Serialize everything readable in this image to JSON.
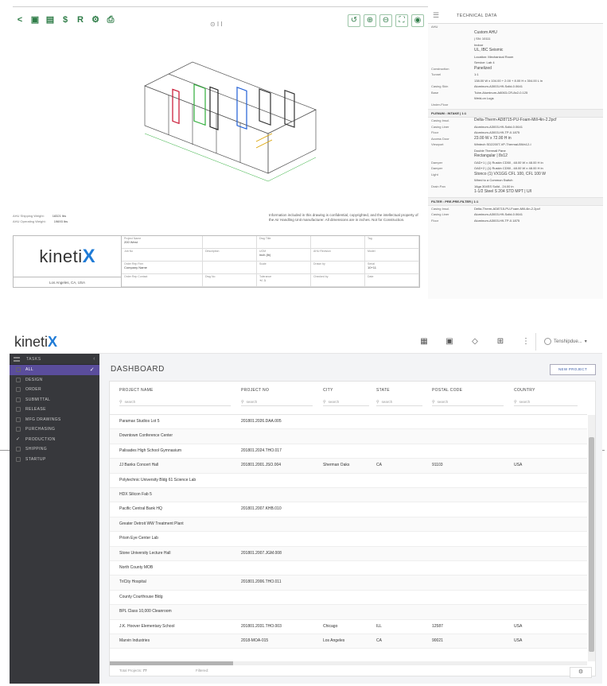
{
  "viewer": {
    "toolbar_left": [
      {
        "icon": "share-icon",
        "glyph": "<"
      },
      {
        "icon": "camera-icon",
        "glyph": "▣"
      },
      {
        "icon": "save-icon",
        "glyph": "▤"
      },
      {
        "icon": "dollar-icon",
        "glyph": "$"
      },
      {
        "icon": "report-icon",
        "glyph": "R"
      },
      {
        "icon": "settings-icon",
        "glyph": "⚙"
      },
      {
        "icon": "print-icon",
        "glyph": "⎙"
      }
    ],
    "toolbar_right": [
      {
        "icon": "rotate-icon",
        "glyph": "↺"
      },
      {
        "icon": "zoom-in-icon",
        "glyph": "⊕"
      },
      {
        "icon": "zoom-out-icon",
        "glyph": "⊖"
      },
      {
        "icon": "fullscreen-icon",
        "glyph": "⛶"
      },
      {
        "icon": "eye-icon",
        "glyph": "◉"
      }
    ],
    "pager": "⊙ I I",
    "weights": [
      {
        "label": "AHU Shipping Weight:",
        "value": "18321 lbs"
      },
      {
        "label": "AHU Operating Weight:",
        "value": "19693 lbs"
      }
    ],
    "notice": "Information included in this drawing is confidential, copyrighted, and the intellectual property of the Air Handling Unit manufacturer. All dimensions are in inches. Not for Construction.",
    "titleblock": {
      "logo_text": "kineti",
      "logo_x": "X",
      "location": "Los Angeles, CA, USA",
      "cells": [
        {
          "label": "Project Name",
          "value": "200 West"
        },
        {
          "label": "",
          "value": ""
        },
        {
          "label": "Dwg Title",
          "value": ""
        },
        {
          "label": "",
          "value": ""
        },
        {
          "label": "Tag",
          "value": ""
        },
        {
          "label": "Job No",
          "value": ""
        },
        {
          "label": "Description",
          "value": ""
        },
        {
          "label": "UOM",
          "value": "inch (lb)"
        },
        {
          "label": "AHU Revision",
          "value": ""
        },
        {
          "label": "Model",
          "value": ""
        },
        {
          "label": "Order Rep Firm",
          "value": "Company Name"
        },
        {
          "label": "",
          "value": ""
        },
        {
          "label": "Scale",
          "value": ""
        },
        {
          "label": "Drawn by",
          "value": ""
        },
        {
          "label": "Serial",
          "value": "10+11"
        },
        {
          "label": "Order Rep Contact",
          "value": ""
        },
        {
          "label": "Dwg No",
          "value": ""
        },
        {
          "label": "Tolerance",
          "value": "+/- 1"
        },
        {
          "label": "Checked by",
          "value": ""
        },
        {
          "label": "Date",
          "value": ""
        }
      ]
    }
  },
  "tech": {
    "title": "TECHNICAL DATA",
    "rows": [
      {
        "type": "row",
        "k": "AHU",
        "v": ""
      },
      {
        "type": "row",
        "k": "",
        "v": "Custom AHU",
        "big": true
      },
      {
        "type": "row",
        "k": "",
        "v": "| SN: 10111"
      },
      {
        "type": "row",
        "k": "",
        "v": "Indoor"
      },
      {
        "type": "row",
        "k": "",
        "v": "UL, IBC Seismic",
        "big": true
      },
      {
        "type": "row",
        "k": "",
        "v": "Location: Mechanical Room"
      },
      {
        "type": "row",
        "k": "",
        "v": "Service: Lab 4"
      },
      {
        "type": "row",
        "k": "Construction",
        "v": "Panelized",
        "big": true
      },
      {
        "type": "row",
        "k": "Tunnel",
        "v": "1:1"
      },
      {
        "type": "row",
        "k": "",
        "v": "138.00 W x 104.00 + 2.00 + 8.00 H x 304.00 L in"
      },
      {
        "type": "row",
        "k": "Casing Skin",
        "v": "Aluminum-A3003-H9-Solid-0.0641"
      },
      {
        "type": "row",
        "k": "Base",
        "v": "Tube-Aluminum-A6063-CR-8x2-0.125"
      },
      {
        "type": "row",
        "k": "",
        "v": "Weld-on Lugs"
      },
      {
        "type": "row",
        "k": "Under-Floor",
        "v": ""
      },
      {
        "type": "sec",
        "v": "PLENUM : INTAKE | 1:1"
      },
      {
        "type": "row",
        "k": "Casing Insul.",
        "v": "Delta-Therm-AD8715-PU-Foam-Mill-4in-2.2pcf",
        "big": true
      },
      {
        "type": "row",
        "k": "Casing Liner",
        "v": "Aluminum-A3003-H9-Solid-0.0641"
      },
      {
        "type": "row",
        "k": "Floor",
        "v": "Aluminum-A3003-H9-TP-0.1875"
      },
      {
        "type": "row",
        "k": "Access Door",
        "v": "23.00 W x 72.00 H in",
        "big": true
      },
      {
        "type": "row",
        "k": "Viewport",
        "v": "Wintech SD2200T-VP-Thermal-BWx12-I"
      },
      {
        "type": "row",
        "k": "",
        "v": "Double Thermall Pane"
      },
      {
        "type": "row",
        "k": "",
        "v": "Rectangular | 8x12",
        "big": true
      },
      {
        "type": "row",
        "k": "Damper",
        "v": "OAD+1 | (1) Ruskin CD50 , 48.00 W x 48.00 H in"
      },
      {
        "type": "row",
        "k": "Damper",
        "v": "OAD+2 | (1) Ruskin CD50 , 48.00 W x 48.00 H in"
      },
      {
        "type": "row",
        "k": "Light",
        "v": "Stonco (1) VX1GG CFL 100, CFL 100 W",
        "big": true
      },
      {
        "type": "row",
        "k": "",
        "v": "Wired to a Common Switch"
      },
      {
        "type": "row",
        "k": "Drain Pan",
        "v": "16ga 304SS Solid , 24.00 in"
      },
      {
        "type": "row",
        "k": "",
        "v": "1-1/2 Steel S 204 STD MPT | U/I",
        "big": true
      },
      {
        "type": "sec",
        "v": "FILTER : PRE-PRE-FILTER | 1:1"
      },
      {
        "type": "row",
        "k": "Casing Insul.",
        "v": "Delta-Therm-AD8715-PU-Foam-Mill-4in-2.2pcf"
      },
      {
        "type": "row",
        "k": "Casing Liner",
        "v": "Aluminum-A3003-H9-Solid-0.0641"
      },
      {
        "type": "row",
        "k": "Floor",
        "v": "Aluminum-A3003-H9-TP-0.1875"
      }
    ]
  },
  "app": {
    "logo_text": "kineti",
    "logo_x": "X",
    "header_icons": [
      "grid-view-icon",
      "calendar-icon",
      "diamond-icon",
      "apps-icon",
      "more-vert-icon"
    ],
    "header_glyphs": [
      "▦",
      "▣",
      "◇",
      "⊞",
      "⋮"
    ],
    "user": "Tenshipdue...",
    "sidebar": {
      "title": "TASKS",
      "items": [
        {
          "label": "ALL",
          "active": true,
          "tick": ""
        },
        {
          "label": "DESIGN",
          "active": false,
          "tick": ""
        },
        {
          "label": "ORDER",
          "active": false,
          "tick": ""
        },
        {
          "label": "SUBMITTAL",
          "active": false,
          "tick": ""
        },
        {
          "label": "RELEASE",
          "active": false,
          "tick": ""
        },
        {
          "label": "MFG DRAWINGS",
          "active": false,
          "tick": ""
        },
        {
          "label": "PURCHASING",
          "active": false,
          "tick": ""
        },
        {
          "label": "PRODUCTION",
          "active": false,
          "tick": "✓"
        },
        {
          "label": "SHIPPING",
          "active": false,
          "tick": ""
        },
        {
          "label": "STARTUP",
          "active": false,
          "tick": ""
        }
      ]
    },
    "dashboard_title": "DASHBOARD",
    "new_project": "NEW PROJECT",
    "columns": [
      "PROJECT NAME",
      "PROJECT NO",
      "CITY",
      "STATE",
      "POSTAL CODE",
      "COUNTRY"
    ],
    "search_placeholder": "search",
    "rows": [
      [
        "Paramax Studios Lot 5",
        "201801.2026.DAA.005",
        "",
        "",
        "",
        ""
      ],
      [
        "Downtown Conference Center",
        "",
        "",
        "",
        "",
        ""
      ],
      [
        "Palisades High School Gymnasium",
        "201801.2024.THO.017",
        "",
        "",
        "",
        ""
      ],
      [
        "JJ Banks Concert Hall",
        "201801.2001.JSO.004",
        "Sherman Oaks",
        "CA",
        "91103",
        "USA"
      ],
      [
        "Polytechnic University Bldg 61 Science Lab",
        "",
        "",
        "",
        "",
        ""
      ],
      [
        "HDX Silicon Fab 5",
        "",
        "",
        "",
        "",
        ""
      ],
      [
        "Pacific Central Bank HQ",
        "201801.2007.KHB.010",
        "",
        "",
        "",
        ""
      ],
      [
        "Greater Detroit WW Treatment Plant",
        "",
        "",
        "",
        "",
        ""
      ],
      [
        "Prism Eye Center Lab",
        "",
        "",
        "",
        "",
        ""
      ],
      [
        "Stone University Lecture Hall",
        "201801.2007.JGM.008",
        "",
        "",
        "",
        ""
      ],
      [
        "North County MOB",
        "",
        "",
        "",
        "",
        ""
      ],
      [
        "TriCity Hospital",
        "201801.2006.THO.011",
        "",
        "",
        "",
        ""
      ],
      [
        "County Courthouse Bldg",
        "",
        "",
        "",
        "",
        ""
      ],
      [
        "BPL Class 10,000 Cleanroom",
        "",
        "",
        "",
        "",
        ""
      ],
      [
        "J.K. Hoover Elementary School",
        "201801.2031.THO.003",
        "Chicago",
        "ILL",
        "12587",
        "USA"
      ],
      [
        "Marvin Industries",
        "2018-MOA-015",
        "Los Angeles",
        "CA",
        "90021",
        "USA"
      ]
    ],
    "total_label": "Total Projects:",
    "total_value": "77",
    "filtered_label": "Filtered:",
    "settings_icon": "⚙"
  }
}
